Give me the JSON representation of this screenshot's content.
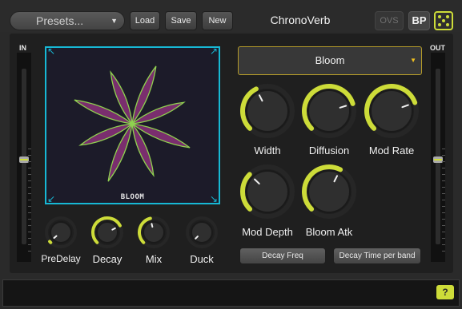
{
  "toolbar": {
    "presets_label": "Presets...",
    "load_label": "Load",
    "save_label": "Save",
    "new_label": "New",
    "plugin_title": "ChronoVerb",
    "ovs_label": "OVS",
    "bp_label": "BP",
    "random_icon": "dice-icon"
  },
  "meters": {
    "in_label": "IN",
    "out_label": "OUT",
    "in_level": 0.48,
    "out_level": 0.48
  },
  "display": {
    "label": "BLOOM",
    "petals": 8,
    "colors": {
      "border": "#17b8d4",
      "petal_fill": "#7a2e6e",
      "petal_stroke": "#8fd14f"
    }
  },
  "mode_select": {
    "value": "Bloom"
  },
  "knobs": {
    "predelay": {
      "label": "PreDelay",
      "value": 0.02
    },
    "decay": {
      "label": "Decay",
      "value": 0.73
    },
    "mix": {
      "label": "Mix",
      "value": 0.45
    },
    "duck": {
      "label": "Duck",
      "value": 0.0
    },
    "width": {
      "label": "Width",
      "value": 0.4
    },
    "diffusion": {
      "label": "Diffusion",
      "value": 0.77
    },
    "mod_rate": {
      "label": "Mod Rate",
      "value": 0.76
    },
    "mod_depth": {
      "label": "Mod Depth",
      "value": 0.33
    },
    "bloom_atk": {
      "label": "Bloom Atk",
      "value": 0.6
    }
  },
  "buttons": {
    "decay_freq": "Decay Freq",
    "decay_time_per_band": "Decay Time per band"
  },
  "help_label": "?",
  "accent_color": "#cddc39"
}
